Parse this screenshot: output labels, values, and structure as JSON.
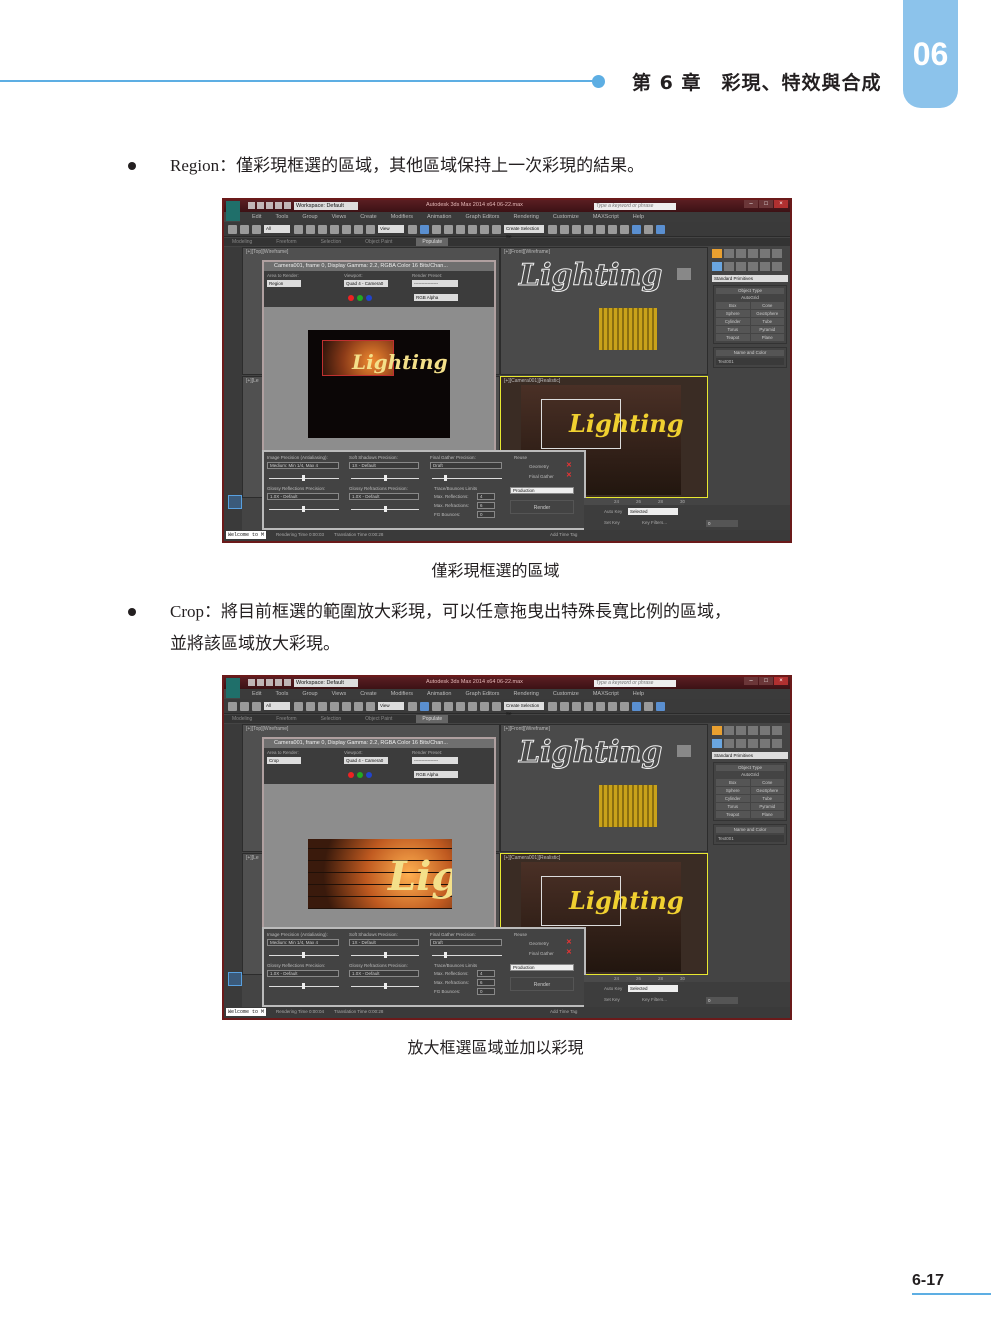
{
  "header": {
    "chapter_title": "第 6 章　彩現、特效與合成",
    "chapter_number": "06",
    "accent_color": "#5daee3",
    "tab_color": "#8cc3eb"
  },
  "sections": [
    {
      "term": "Region",
      "text": "Region：僅彩現框選的區域，其他區域保持上一次彩現的結果。",
      "caption": "僅彩現框選的區域"
    },
    {
      "term": "Crop",
      "text_line1": "Crop：將目前框選的範圍放大彩現，可以任意拖曳出特殊長寬比例的區域，",
      "text_line2": "並將該區域放大彩現。",
      "caption": "放大框選區域並加以彩現"
    }
  ],
  "screenshots": [
    {
      "app": {
        "title": "Autodesk 3ds Max 2014 x64    06-22.max",
        "workspace": "Workspace: Default",
        "search_placeholder": "Type a keyword or phrase",
        "menus": [
          "Edit",
          "Tools",
          "Group",
          "Views",
          "Create",
          "Modifiers",
          "Animation",
          "Graph Editors",
          "Rendering",
          "Customize",
          "MAXScript",
          "Help"
        ],
        "selection_filter": "All",
        "ref_coord": "View",
        "named_sel": "Create Selection Se",
        "ribbon_tabs": [
          "Modeling",
          "Freeform",
          "Selection",
          "Object Paint",
          "Populate"
        ],
        "ribbon_active": "Populate",
        "viewport_top_left": "[+][Top][Wireframe]",
        "viewport_front": "[+][Front][Wireframe]",
        "viewport_camera": "[+][Camera001][Realistic]",
        "viewport_left_stub": "[+][Le",
        "neon_text": "Lighting"
      },
      "command_panel": {
        "dropdown": "Standard Primitives",
        "rollout_object_type": "Object Type",
        "autogrid": "AutoGrid",
        "primitives": [
          "Box",
          "Cone",
          "Sphere",
          "GeoSphere",
          "Cylinder",
          "Tube",
          "Torus",
          "Pyramid",
          "Teapot",
          "Plane"
        ],
        "rollout_name_color": "Name and Color",
        "object_name": "Text001"
      },
      "frame_window": {
        "title": "Camera001, frame 0, Display Gamma: 2.2, RGBA Color 16 Bits/Chan...",
        "area_to_render_label": "Area to Render:",
        "area_to_render": "Region",
        "viewport_label": "Viewport:",
        "viewport": "Quad 4 - Camera0",
        "render_preset_label": "Render Preset:",
        "render_preset": "----------------",
        "channel": "RGB Alpha"
      },
      "render_setup": {
        "image_precision_label": "Image Precision (Antialiasing):",
        "image_precision": "Medium: Min 1/4, Max 4",
        "soft_shadows_label": "Soft Shadows Precision:",
        "soft_shadows": "1X - Default",
        "final_gather_label": "Final Gather Precision:",
        "final_gather": "Draft",
        "glossy_reflections_label": "Glossy Reflections Precision:",
        "glossy_reflections": "1.0X - Default",
        "glossy_refractions_label": "Glossy Refractions Precision:",
        "glossy_refractions": "1.0X - Default",
        "trace_label": "Trace/Bounces Limits",
        "max_reflections_label": "Max. Reflections:",
        "max_reflections": "4",
        "max_refractions_label": "Max. Refractions:",
        "max_refractions": "6",
        "fg_bounces_label": "FG Bounces:",
        "fg_bounces": "0",
        "reuse_label": "Reuse",
        "reuse_geometry": "Geometry",
        "reuse_final_gather": "Final Gather",
        "mode": "Production",
        "render_button": "Render"
      },
      "status": {
        "welcome": "Welcome to M",
        "rendering_time": "Rendering Time  0:00:03",
        "translation_time": "Translation Time  0:00:28",
        "add_time_tag": "Add Time Tag",
        "auto_key": "Auto Key",
        "set_key": "Set Key",
        "key_mode": "Selected",
        "key_filters": "Key Filters...",
        "frame": "0",
        "timeline_ticks": [
          "24",
          "26",
          "28",
          "30"
        ]
      }
    },
    {
      "app": {
        "title": "Autodesk 3ds Max 2014 x64    06-22.max",
        "workspace": "Workspace: Default",
        "search_placeholder": "Type a keyword or phrase",
        "menus": [
          "Edit",
          "Tools",
          "Group",
          "Views",
          "Create",
          "Modifiers",
          "Animation",
          "Graph Editors",
          "Rendering",
          "Customize",
          "MAXScript",
          "Help"
        ],
        "selection_filter": "All",
        "ref_coord": "View",
        "named_sel": "Create Selection Se",
        "ribbon_tabs": [
          "Modeling",
          "Freeform",
          "Selection",
          "Object Paint",
          "Populate"
        ],
        "ribbon_active": "Populate",
        "viewport_top_left": "[+][Top][Wireframe]",
        "viewport_front": "[+][Front][Wireframe]",
        "viewport_camera": "[+][Camera001][Realistic]",
        "viewport_left_stub": "[+][Le",
        "neon_text": "Lighting"
      },
      "command_panel": {
        "dropdown": "Standard Primitives",
        "rollout_object_type": "Object Type",
        "autogrid": "AutoGrid",
        "primitives": [
          "Box",
          "Cone",
          "Sphere",
          "GeoSphere",
          "Cylinder",
          "Tube",
          "Torus",
          "Pyramid",
          "Teapot",
          "Plane"
        ],
        "rollout_name_color": "Name and Color",
        "object_name": "Text001"
      },
      "frame_window": {
        "title": "Camera001, frame 0, Display Gamma: 2.2, RGBA Color 16 Bits/Chan...",
        "area_to_render_label": "Area to Render:",
        "area_to_render": "Crop",
        "viewport_label": "Viewport:",
        "viewport": "Quad 4 - Camera0",
        "render_preset_label": "Render Preset:",
        "render_preset": "----------------",
        "channel": "RGB Alpha"
      },
      "render_setup": {
        "image_precision_label": "Image Precision (Antialiasing):",
        "image_precision": "Medium: Min 1/4, Max 4",
        "soft_shadows_label": "Soft Shadows Precision:",
        "soft_shadows": "1X - Default",
        "final_gather_label": "Final Gather Precision:",
        "final_gather": "Draft",
        "glossy_reflections_label": "Glossy Reflections Precision:",
        "glossy_reflections": "1.0X - Default",
        "glossy_refractions_label": "Glossy Refractions Precision:",
        "glossy_refractions": "1.0X - Default",
        "trace_label": "Trace/Bounces Limits",
        "max_reflections_label": "Max. Reflections:",
        "max_reflections": "4",
        "max_refractions_label": "Max. Refractions:",
        "max_refractions": "6",
        "fg_bounces_label": "FG Bounces:",
        "fg_bounces": "0",
        "reuse_label": "Reuse",
        "reuse_geometry": "Geometry",
        "reuse_final_gather": "Final Gather",
        "mode": "Production",
        "render_button": "Render"
      },
      "status": {
        "welcome": "Welcome to M",
        "rendering_time": "Rendering Time  0:00:04",
        "translation_time": "Translation Time  0:00:28",
        "add_time_tag": "Add Time Tag",
        "auto_key": "Auto Key",
        "set_key": "Set Key",
        "key_mode": "Selected",
        "key_filters": "Key Filters...",
        "frame": "0",
        "timeline_ticks": [
          "24",
          "26",
          "28",
          "30"
        ]
      }
    }
  ],
  "footer": {
    "page_number": "6-17"
  }
}
